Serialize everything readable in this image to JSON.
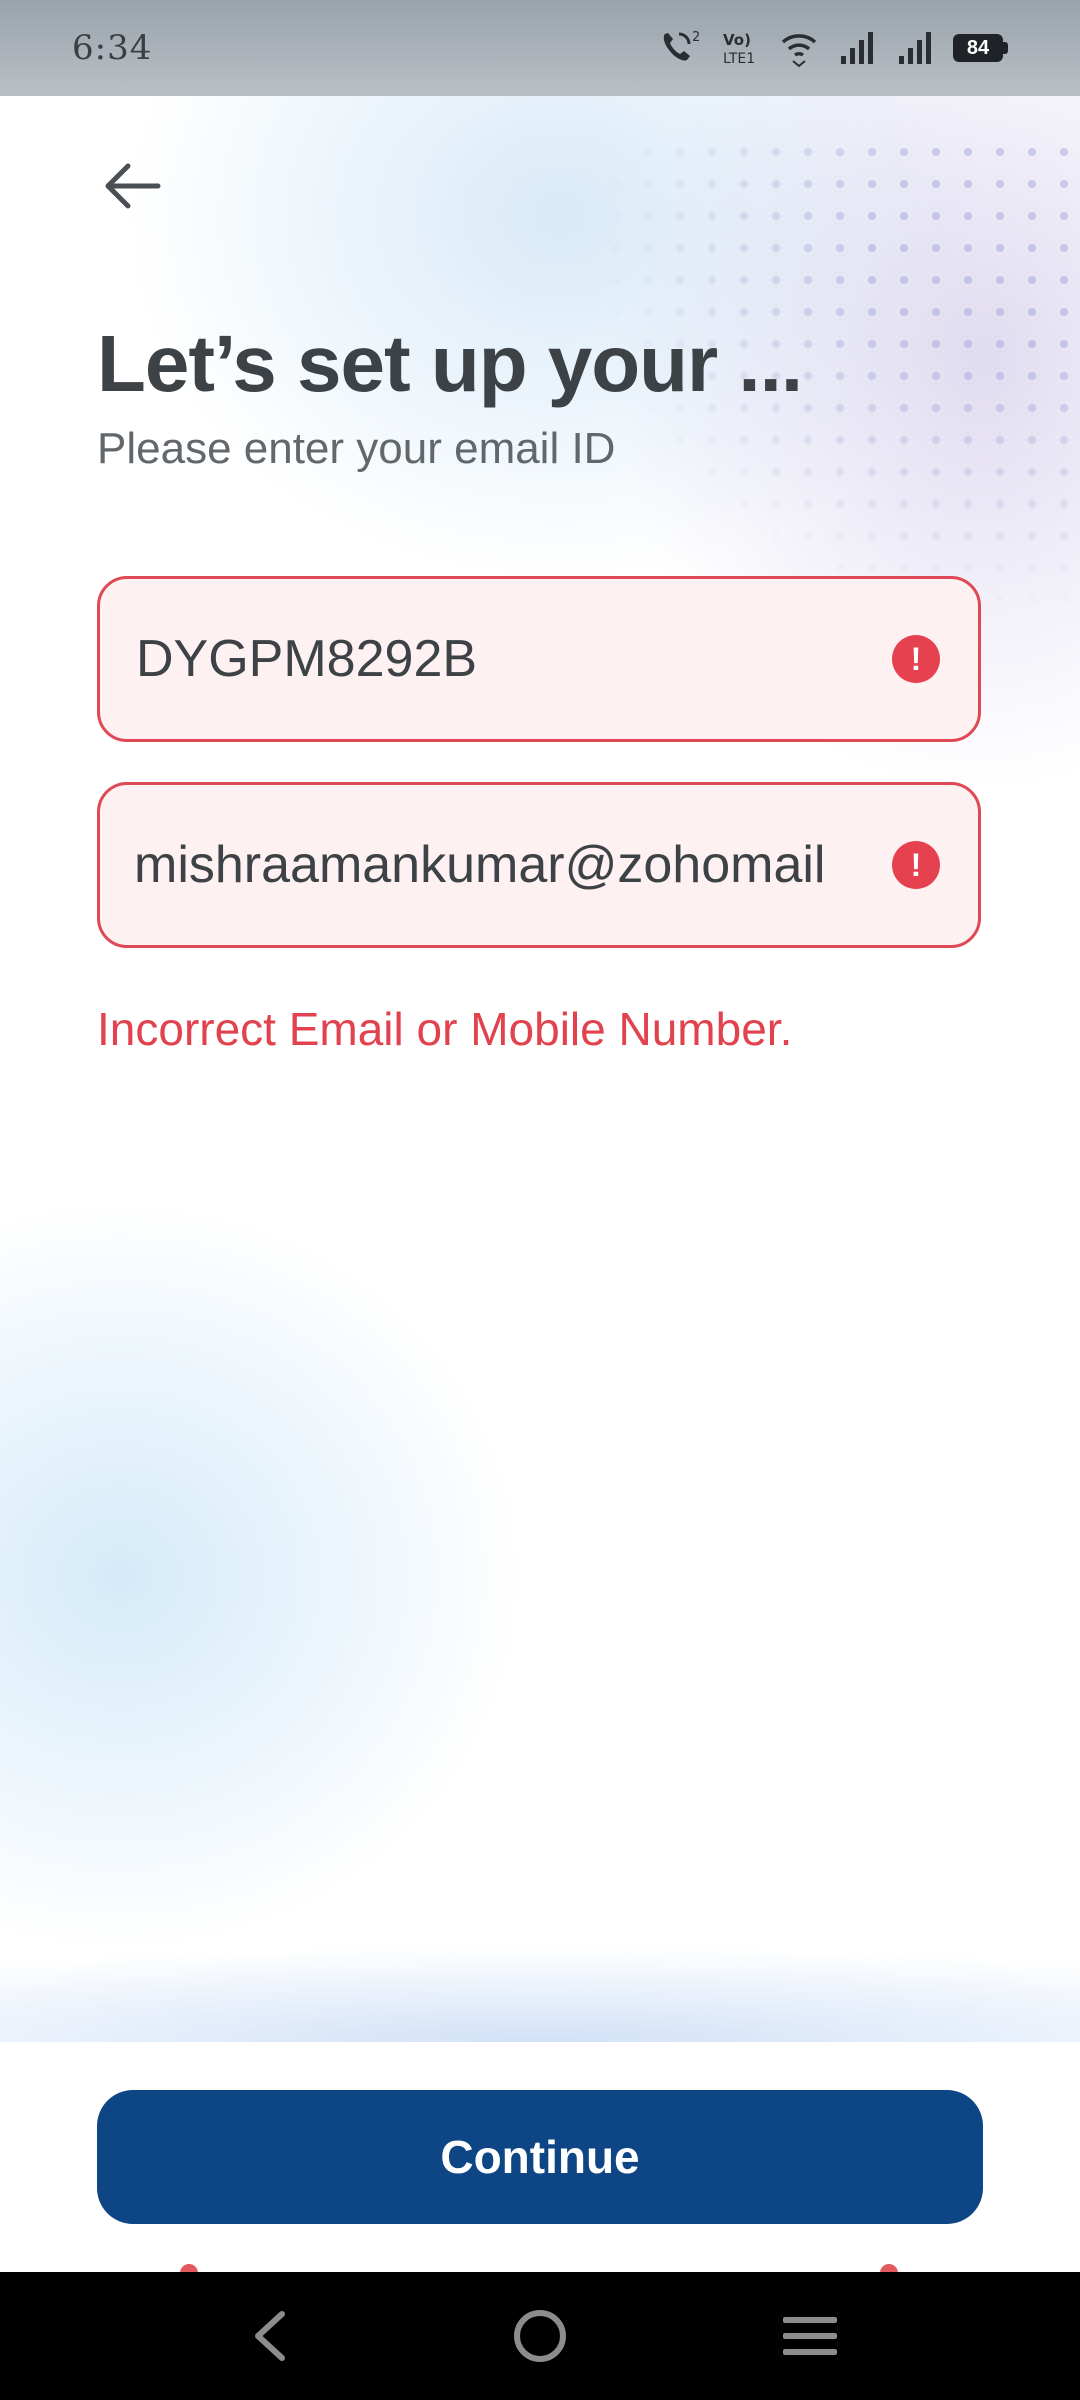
{
  "status_bar": {
    "time": "6:34",
    "battery_level": "84",
    "icons": [
      "call-icon",
      "volte-icon",
      "wifi-icon",
      "signal-icon",
      "signal-icon",
      "battery-icon"
    ]
  },
  "header": {
    "back_icon": "arrow-left-icon",
    "title": "Let’s set up your ...",
    "subtitle": "Please enter your email ID"
  },
  "form": {
    "fields": [
      {
        "value": "DYGPM8292B",
        "status": "error",
        "icon": "error-icon"
      },
      {
        "value": "mishraamankumar@zohomail",
        "status": "error",
        "icon": "error-icon"
      }
    ],
    "error_message": "Incorrect Email or Mobile Number."
  },
  "footer": {
    "continue_label": "Continue"
  },
  "nav_bar": {
    "items": [
      "back-icon",
      "home-icon",
      "menu-icon"
    ]
  },
  "colors": {
    "primary": "#0d4585",
    "error": "#e2424d",
    "error_background": "#fdf1f1",
    "title_text": "#3d4247"
  }
}
